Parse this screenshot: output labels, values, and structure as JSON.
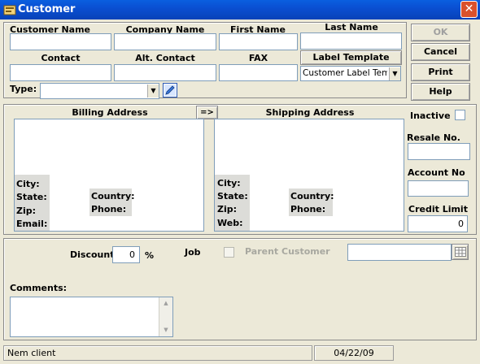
{
  "window": {
    "title": "Customer",
    "close_glyph": "✕"
  },
  "labels": {
    "customer_name": "Customer Name",
    "company_name": "Company Name",
    "first_name": "First Name",
    "last_name": "Last Name",
    "contact": "Contact",
    "alt_contact": "Alt. Contact",
    "fax": "FAX",
    "label_template": "Label Template",
    "type": "Type:",
    "billing_address": "Billing Address",
    "shipping_address": "Shipping Address",
    "copy_arrow": "=>",
    "inactive": "Inactive",
    "resale_no": "Resale No.",
    "account_no": "Account No",
    "credit_limit": "Credit Limit",
    "billing_city": "City:",
    "billing_state": "State:",
    "billing_zip": "Zip:",
    "billing_email": "Email:",
    "billing_country": "Country:",
    "billing_phone": "Phone:",
    "shipping_city": "City:",
    "shipping_state": "State:",
    "shipping_zip": "Zip:",
    "shipping_web": "Web:",
    "shipping_country": "Country:",
    "shipping_phone": "Phone:",
    "discount": "Discount",
    "percent": "%",
    "job": "Job",
    "parent_customer": "Parent Customer",
    "comments": "Comments:"
  },
  "buttons": {
    "ok": "OK",
    "cancel": "Cancel",
    "print": "Print",
    "help": "Help"
  },
  "values": {
    "label_template_selected": "Customer Label Temp",
    "credit_limit": "0",
    "discount": "0"
  },
  "status_bar": {
    "message": "Nem client",
    "date": "04/22/09"
  },
  "colors": {
    "titlebar": "#0a4fd2",
    "close": "#d9512c"
  },
  "icons": {
    "app": "customer-app-icon",
    "edit": "edit-pencil-icon",
    "grid": "grid-lookup-icon"
  }
}
